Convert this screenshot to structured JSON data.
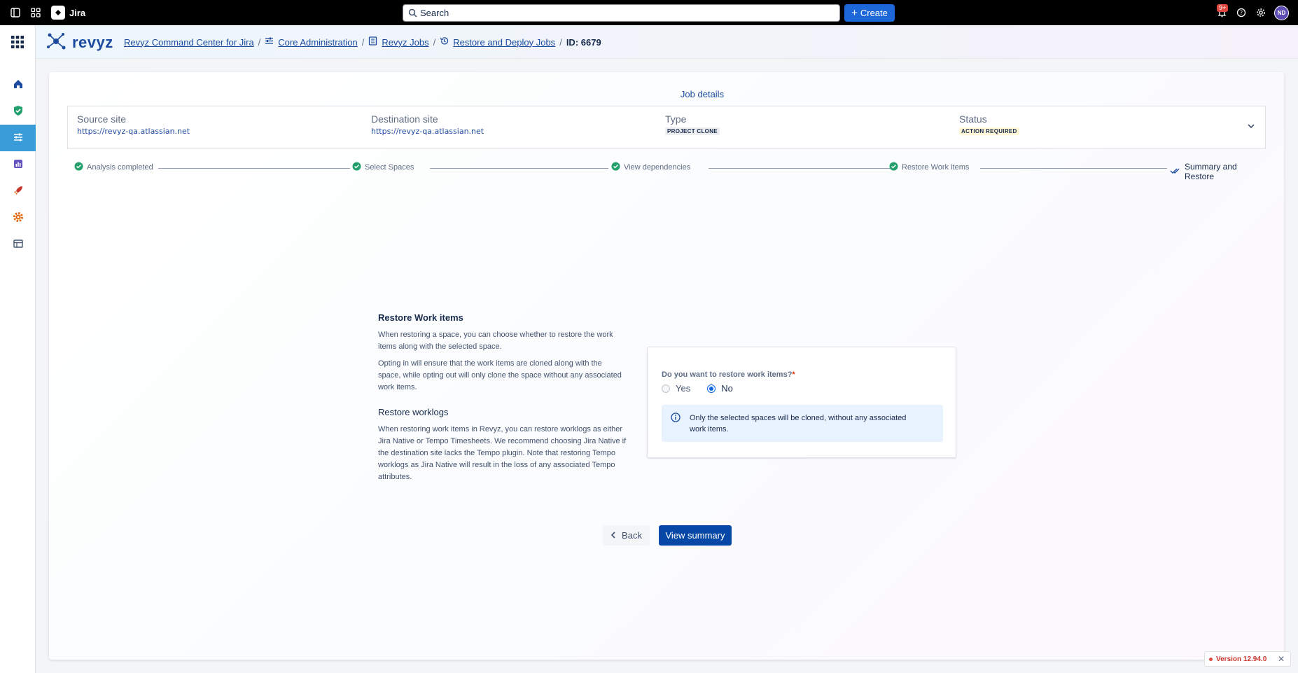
{
  "topbar": {
    "app_name": "Jira",
    "search_placeholder": "Search",
    "create_label": "Create",
    "notifications_badge": "9+",
    "avatar_initials": "ND"
  },
  "header": {
    "logo_text": "revyz",
    "breadcrumbs": [
      {
        "label": "Revyz Command Center for Jira"
      },
      {
        "label": "Core Administration"
      },
      {
        "label": "Revyz Jobs"
      },
      {
        "label": "Restore and Deploy Jobs"
      }
    ],
    "current": "ID: 6679"
  },
  "tab": {
    "label": "Job details"
  },
  "job": {
    "source_label": "Source site",
    "source_value": "https://revyz-qa.atlassian.net",
    "dest_label": "Destination site",
    "dest_value": "https://revyz-qa.atlassian.net",
    "type_label": "Type",
    "type_value": "PROJECT CLONE",
    "status_label": "Status",
    "status_value": "ACTION REQUIRED"
  },
  "steps": [
    {
      "label": "Analysis completed",
      "state": "done"
    },
    {
      "label": "Select Spaces",
      "state": "done"
    },
    {
      "label": "View dependencies",
      "state": "done"
    },
    {
      "label": "Restore Work items",
      "state": "done"
    },
    {
      "label": "Summary and Restore",
      "state": "current"
    }
  ],
  "info": {
    "title1": "Restore Work items",
    "p1": "When restoring a space, you can choose whether to restore the work items along with the selected space.",
    "p2": "Opting in will ensure that the work items are cloned along with the space, while opting out will only clone the space without any associated work items.",
    "title2": "Restore worklogs",
    "p3": "When restoring work items in Revyz, you can restore worklogs as either Jira Native or Tempo Timesheets. We recommend choosing Jira Native if the destination site lacks the Tempo plugin. Note that restoring Tempo worklogs as Jira Native will result in the loss of any associated Tempo attributes."
  },
  "form": {
    "question": "Do you want to restore work items?",
    "required_mark": "*",
    "yes_label": "Yes",
    "no_label": "No",
    "selected": "No",
    "message": "Only the selected spaces will be cloned, without any associated work items."
  },
  "actions": {
    "back": "Back",
    "view_summary": "View summary"
  },
  "version": {
    "label": "Version 12.94.0"
  },
  "colors": {
    "brand": "#1b4a9e",
    "primary_button": "#0747a6",
    "active_nav": "#3a9bd9",
    "success": "#22a06b"
  }
}
